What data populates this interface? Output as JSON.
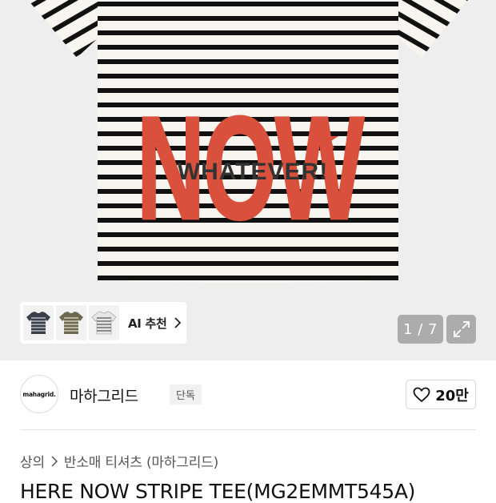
{
  "gallery": {
    "print_main_text": "NOW",
    "print_sub_text": "WHATEVER!",
    "page_counter": "1 / 7",
    "colors": {
      "background": "#eeeeee",
      "stripe": "#111111",
      "shirt": "#f7f5ef",
      "print": "#d9503c"
    },
    "icons": {
      "expand": "expand-icon",
      "chevron": "chevron-right-icon"
    }
  },
  "ai_recommend": {
    "label": "AI 추천",
    "thumbnails": [
      "navy-stripe-tee",
      "khaki-stripe-tee",
      "grey-stripe-tee"
    ]
  },
  "brand": {
    "logo_text": "mahagrid.",
    "name": "마하그리드",
    "badge": "단독"
  },
  "like": {
    "icon": "heart-icon",
    "count": "20만"
  },
  "breadcrumb": {
    "items": [
      "상의",
      "반소매 티셔츠 (마하그리드)"
    ]
  },
  "product": {
    "title": "HERE NOW STRIPE TEE(MG2EMMT545A)"
  }
}
